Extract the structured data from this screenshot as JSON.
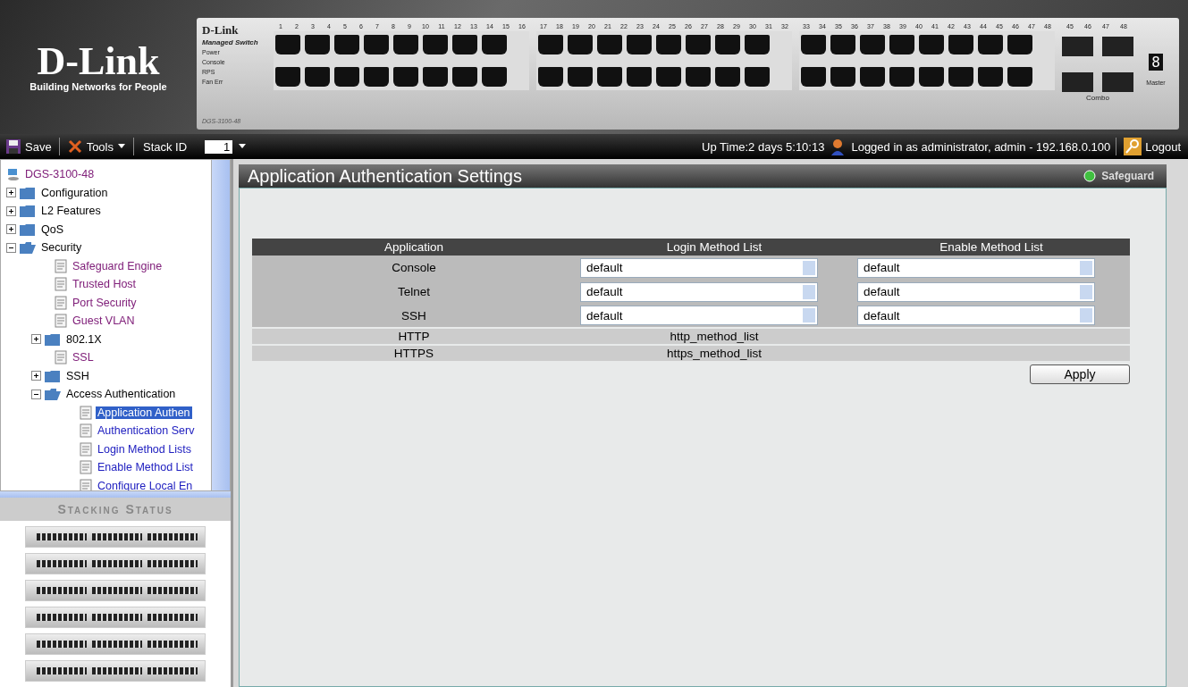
{
  "banner": {
    "brand": "D-Link",
    "tagline": "Building Networks for People",
    "device_brand": "D-Link",
    "device_subtitle": "Managed Switch",
    "device_model": "DGS-3100-48",
    "led_labels": [
      "Power",
      "Console",
      "RPS",
      "Fan Err"
    ],
    "port_groups": [
      [
        "1",
        "2",
        "3",
        "4",
        "5",
        "6",
        "7",
        "8",
        "9",
        "10",
        "11",
        "12",
        "13",
        "14",
        "15",
        "16"
      ],
      [
        "17",
        "18",
        "19",
        "20",
        "21",
        "22",
        "23",
        "24",
        "25",
        "26",
        "27",
        "28",
        "29",
        "30",
        "31",
        "32"
      ],
      [
        "33",
        "34",
        "35",
        "36",
        "37",
        "38",
        "39",
        "40",
        "41",
        "42",
        "43",
        "44",
        "45",
        "46",
        "47",
        "48"
      ]
    ],
    "combo_ports": [
      "45",
      "46",
      "47",
      "48"
    ],
    "combo_label": "Combo",
    "stack_digit": "8",
    "master_label": "Master"
  },
  "toolbar": {
    "save": "Save",
    "tools": "Tools",
    "stack_id_label": "Stack ID",
    "stack_id": "1",
    "uptime": "Up Time:2 days 5:10:13",
    "login_info": "Logged in as administrator, admin - 192.168.0.100",
    "logout": "Logout"
  },
  "tree": {
    "label": "DGS-3100-48",
    "visited": true,
    "children": [
      {
        "label": "Configuration",
        "kind": "folder",
        "expanded": false
      },
      {
        "label": "L2 Features",
        "kind": "folder",
        "expanded": false
      },
      {
        "label": "QoS",
        "kind": "folder",
        "expanded": false
      },
      {
        "label": "Security",
        "kind": "folder",
        "expanded": true,
        "children": [
          {
            "label": "Safeguard Engine",
            "kind": "page",
            "visited": true,
            "selected": false
          },
          {
            "label": "Trusted Host",
            "kind": "page",
            "visited": true,
            "selected": false
          },
          {
            "label": "Port Security",
            "kind": "page",
            "visited": true,
            "selected": false
          },
          {
            "label": "Guest VLAN",
            "kind": "page",
            "visited": true,
            "selected": false
          },
          {
            "label": "802.1X",
            "kind": "folder",
            "expanded": false
          },
          {
            "label": "SSL",
            "kind": "page",
            "visited": true,
            "selected": false
          },
          {
            "label": "SSH",
            "kind": "folder",
            "expanded": false
          },
          {
            "label": "Access Authentication",
            "kind": "folder",
            "expanded": true,
            "children": [
              {
                "label": "Application Authen",
                "kind": "page",
                "selected": true
              },
              {
                "label": "Authentication Serv",
                "kind": "page",
                "visited": false,
                "selected": false
              },
              {
                "label": "Login Method Lists",
                "kind": "page",
                "visited": false,
                "selected": false
              },
              {
                "label": "Enable Method List",
                "kind": "page",
                "visited": false,
                "selected": false
              },
              {
                "label": "Configure Local En",
                "kind": "page",
                "visited": false,
                "selected": false
              }
            ]
          }
        ]
      }
    ]
  },
  "stacking": {
    "title": "Stacking Status"
  },
  "panel": {
    "title": "Application Authentication Settings",
    "safeguard": "Safeguard",
    "columns": [
      "Application",
      "Login Method List",
      "Enable Method List"
    ],
    "rows": [
      {
        "kind": "select",
        "application": "Console",
        "login": "default",
        "enable": "default"
      },
      {
        "kind": "select",
        "application": "Telnet",
        "login": "default",
        "enable": "default"
      },
      {
        "kind": "select",
        "application": "SSH",
        "login": "default",
        "enable": "default"
      },
      {
        "kind": "text",
        "application": "HTTP",
        "login": "http_method_list"
      },
      {
        "kind": "text",
        "application": "HTTPS",
        "login": "https_method_list"
      }
    ],
    "apply": "Apply"
  }
}
